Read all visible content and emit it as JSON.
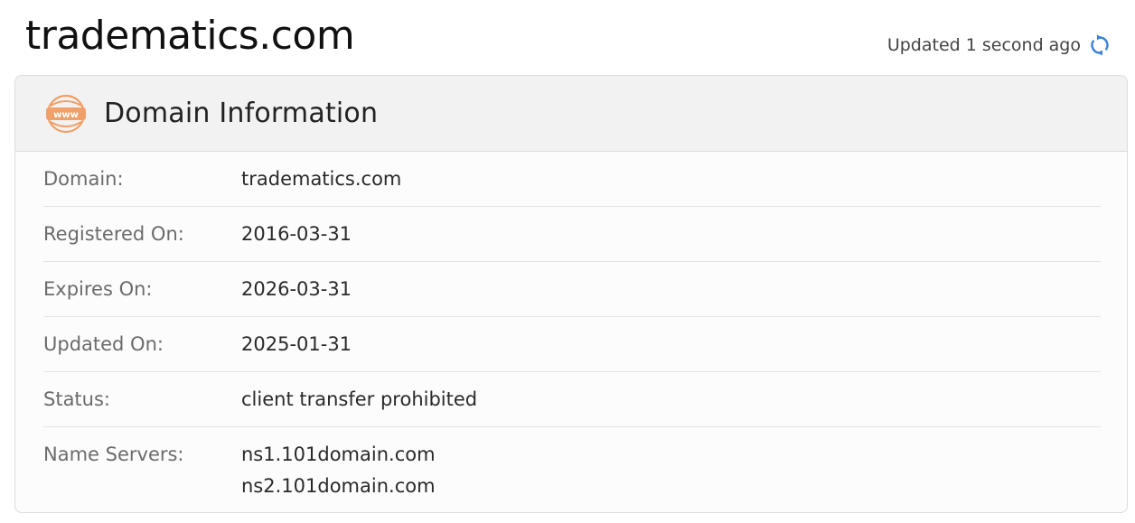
{
  "header": {
    "site_title": "tradematics.com",
    "updated_text": "Updated 1 second ago",
    "refresh_icon": "refresh-icon"
  },
  "card": {
    "icon": "www-icon",
    "title": "Domain Information",
    "rows": [
      {
        "label": "Domain:",
        "value": "tradematics.com"
      },
      {
        "label": "Registered On:",
        "value": "2016-03-31"
      },
      {
        "label": "Expires On:",
        "value": "2026-03-31"
      },
      {
        "label": "Updated On:",
        "value": "2025-01-31"
      },
      {
        "label": "Status:",
        "value": "client transfer prohibited"
      }
    ],
    "name_servers": {
      "label": "Name Servers:",
      "values": [
        "ns1.101domain.com",
        "ns2.101domain.com"
      ]
    }
  },
  "colors": {
    "accent_orange": "#f0a068",
    "refresh_blue": "#3a82d6",
    "header_bg": "#f2f2f2",
    "border": "#dcdcdc"
  }
}
